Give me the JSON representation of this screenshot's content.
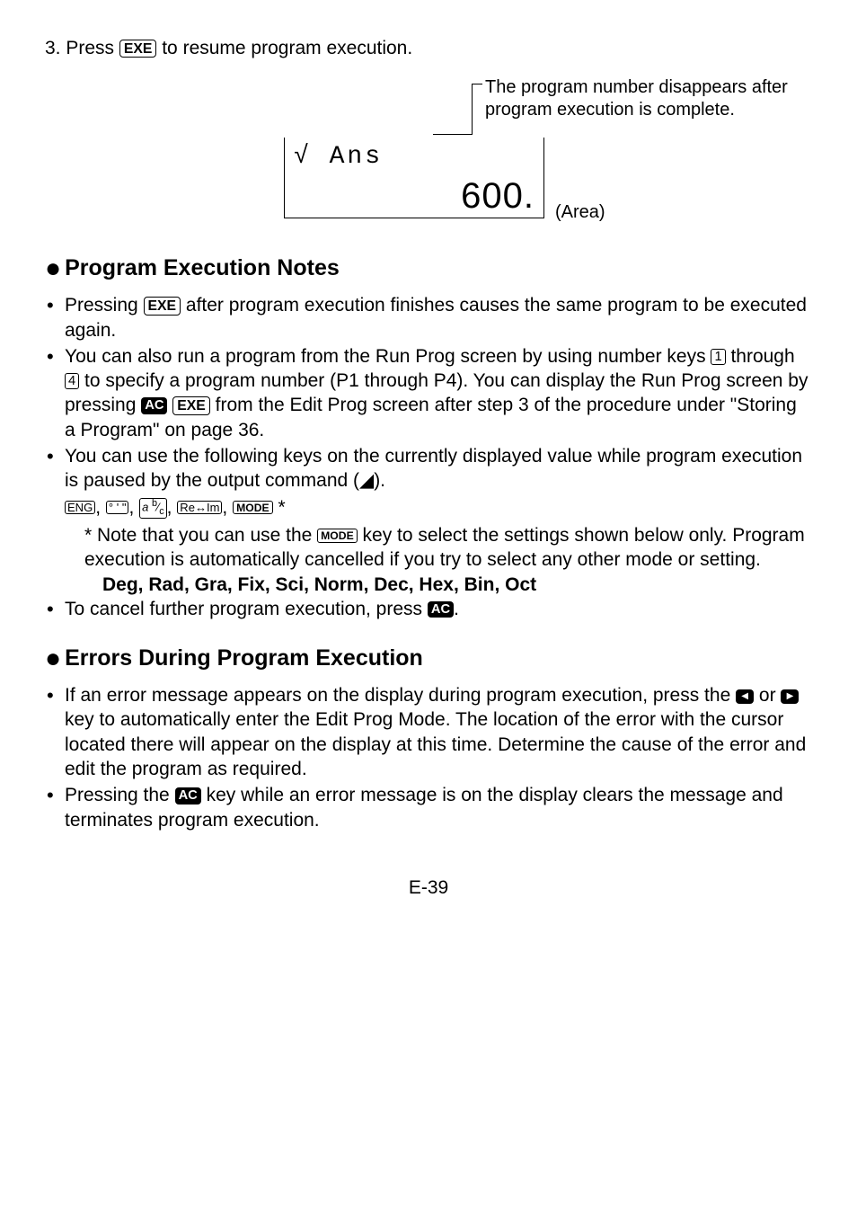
{
  "step3": {
    "prefix": "3. Press ",
    "key": "EXE",
    "suffix": " to resume program execution."
  },
  "diagram": {
    "caption_l1": "The program number disappears after",
    "caption_l2": "program execution is complete.",
    "lcd_expr": "√  Ans",
    "lcd_result": "600.",
    "area": "(Area)"
  },
  "sec1": {
    "title": "Program Execution Notes",
    "b1_a": "Pressing ",
    "b1_key": "EXE",
    "b1_b": " after program execution finishes causes the same program to be executed again.",
    "b2_a": "You can also run a program from the Run Prog screen by using number keys ",
    "b2_k1": "1",
    "b2_mid": " through ",
    "b2_k4": "4",
    "b2_b": " to specify a program number (P1 through P4). You can display the Run Prog screen by pressing ",
    "b2_ac": "AC",
    "b2_exe": "EXE",
    "b2_c": " from the Edit Prog screen after step 3 of the procedure under \"Storing a Program\" on page 36.",
    "b3_a": "You can use the following keys on the currently displayed value while program execution is paused by the output command (",
    "b3_b": ").",
    "keys": {
      "eng": "ENG",
      "dms": "° ' \"",
      "abc": "a b⁄c",
      "reim": "Re↔Im",
      "mode": "MODE"
    },
    "note_a": "* Note that you can use the ",
    "note_key": "MODE",
    "note_b": " key to select the settings shown below only. Program execution is automatically cancelled if you try to select any other mode or setting.",
    "modes": "Deg, Rad, Gra, Fix, Sci, Norm, Dec, Hex, Bin, Oct",
    "b4_a": "To cancel further program execution, press ",
    "b4_ac": "AC",
    "b4_b": "."
  },
  "sec2": {
    "title": "Errors During Program Execution",
    "b1_a": "If an error message appears on the display during program execution, press the ",
    "b1_b": " or ",
    "b1_c": " key to automatically enter the Edit Prog Mode. The location of the error with the cursor located there will appear on the display at this time. Determine the cause of the error and edit the program as required.",
    "b2_a": "Pressing the ",
    "b2_ac": "AC",
    "b2_b": " key while an error message is on the display clears the message and terminates program execution."
  },
  "page": "E-39"
}
